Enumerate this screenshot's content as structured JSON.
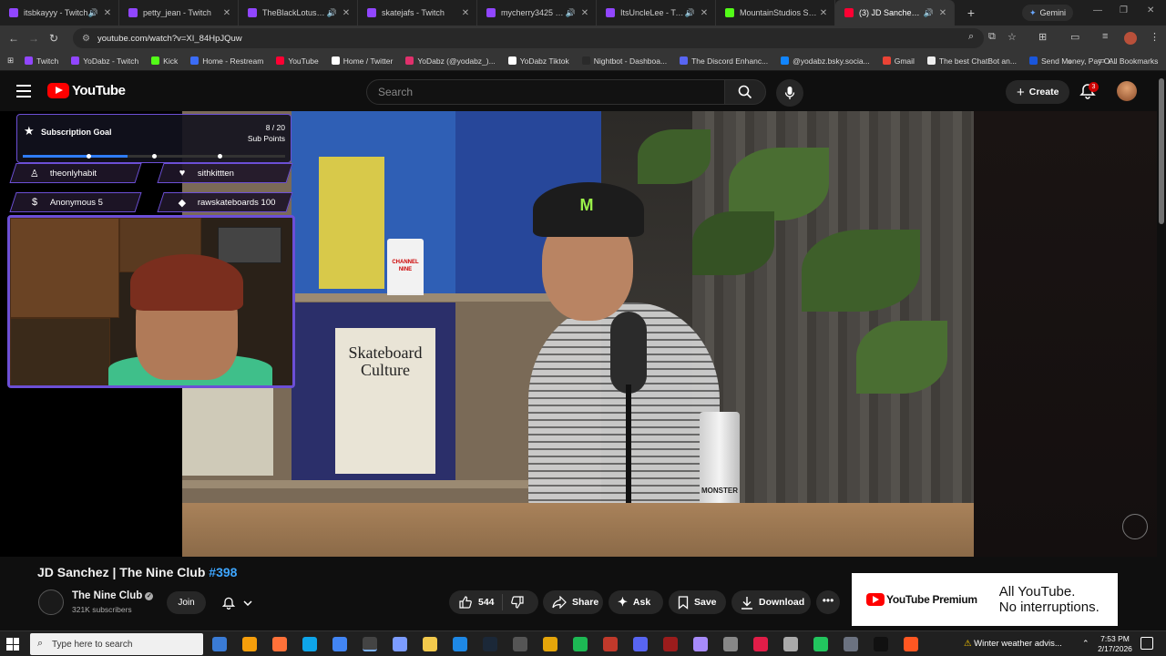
{
  "browser": {
    "tabs": [
      {
        "label": "itsbkayyy - Twitch",
        "color": "#9146ff",
        "audio": true
      },
      {
        "label": "petty_jean - Twitch",
        "color": "#9146ff",
        "audio": false
      },
      {
        "label": "TheBlackLotus12 - Tw",
        "color": "#9146ff",
        "audio": true
      },
      {
        "label": "skatejafs - Twitch",
        "color": "#9146ff",
        "audio": false
      },
      {
        "label": "mycherry3425 - Twi",
        "color": "#9146ff",
        "audio": true
      },
      {
        "label": "ItsUncleLee - Twitch",
        "color": "#9146ff",
        "audio": true
      },
      {
        "label": "MountainStudios Strea",
        "color": "#53fc18",
        "audio": false
      },
      {
        "label": "(3) JD Sanchez | The",
        "color": "#ff0033",
        "audio": true
      }
    ],
    "new_tab": "+",
    "gemini_label": "Gemini",
    "url": "youtube.com/watch?v=XI_84HpJQuw",
    "bookmarks": [
      {
        "label": "Twitch",
        "color": "#9146ff"
      },
      {
        "label": "YoDabz - Twitch",
        "color": "#9146ff"
      },
      {
        "label": "Kick",
        "color": "#53fc18"
      },
      {
        "label": "Home - Restream",
        "color": "#3b6cf6"
      },
      {
        "label": "YouTube",
        "color": "#ff0033"
      },
      {
        "label": "Home / Twitter",
        "color": "#ffffff"
      },
      {
        "label": "YoDabz (@yodabz_)...",
        "color": "#e1306c"
      },
      {
        "label": "YoDabz Tiktok",
        "color": "#ffffff"
      },
      {
        "label": "Nightbot - Dashboa...",
        "color": "#2a2a2a"
      },
      {
        "label": "The Discord Enhanc...",
        "color": "#5865f2"
      },
      {
        "label": "@yodabz.bsky.socia...",
        "color": "#1185fe"
      },
      {
        "label": "Gmail",
        "color": "#ea4335"
      },
      {
        "label": "The best ChatBot an...",
        "color": "#eeeeee"
      },
      {
        "label": "Send Money, Pay O...",
        "color": "#1a56db"
      }
    ],
    "all_bookmarks": "All Bookmarks"
  },
  "youtube": {
    "logo": "YouTube",
    "search_placeholder": "Search",
    "create_label": "Create",
    "notifications": "3"
  },
  "overlay": {
    "sub_goal_title": "Subscription Goal",
    "sub_goal_count": "8 / 20",
    "sub_goal_unit": "Sub Points",
    "sub_goal_progress": 0.4,
    "events": [
      {
        "label": "theonlyhabit",
        "icon": "person-icon"
      },
      {
        "label": "sithkittten",
        "icon": "heart-icon"
      },
      {
        "label": "Anonymous 5",
        "icon": "dollar-icon"
      },
      {
        "label": "rawskateboards 100",
        "icon": "diamond-icon"
      }
    ],
    "video_text": {
      "book_title": "Skateboard Culture",
      "mug_label": "CHANNEL NINE",
      "can_label": "MONSTER"
    }
  },
  "video": {
    "title_main": "JD Sanchez | The Nine Club ",
    "title_tag": "#398",
    "channel_name": "The Nine Club",
    "subscribers": "321K subscribers",
    "join_label": "Join",
    "likes": "544",
    "share_label": "Share",
    "ask_label": "Ask",
    "save_label": "Save",
    "download_label": "Download",
    "more_label": "•••"
  },
  "premium": {
    "logo": "YouTube Premium",
    "line1": "All YouTube.",
    "line2": "No interruptions."
  },
  "taskbar": {
    "search_placeholder": "Type here to search",
    "weather": "Winter weather advis...",
    "time": "7:53 PM",
    "date": "2/17/2026"
  }
}
